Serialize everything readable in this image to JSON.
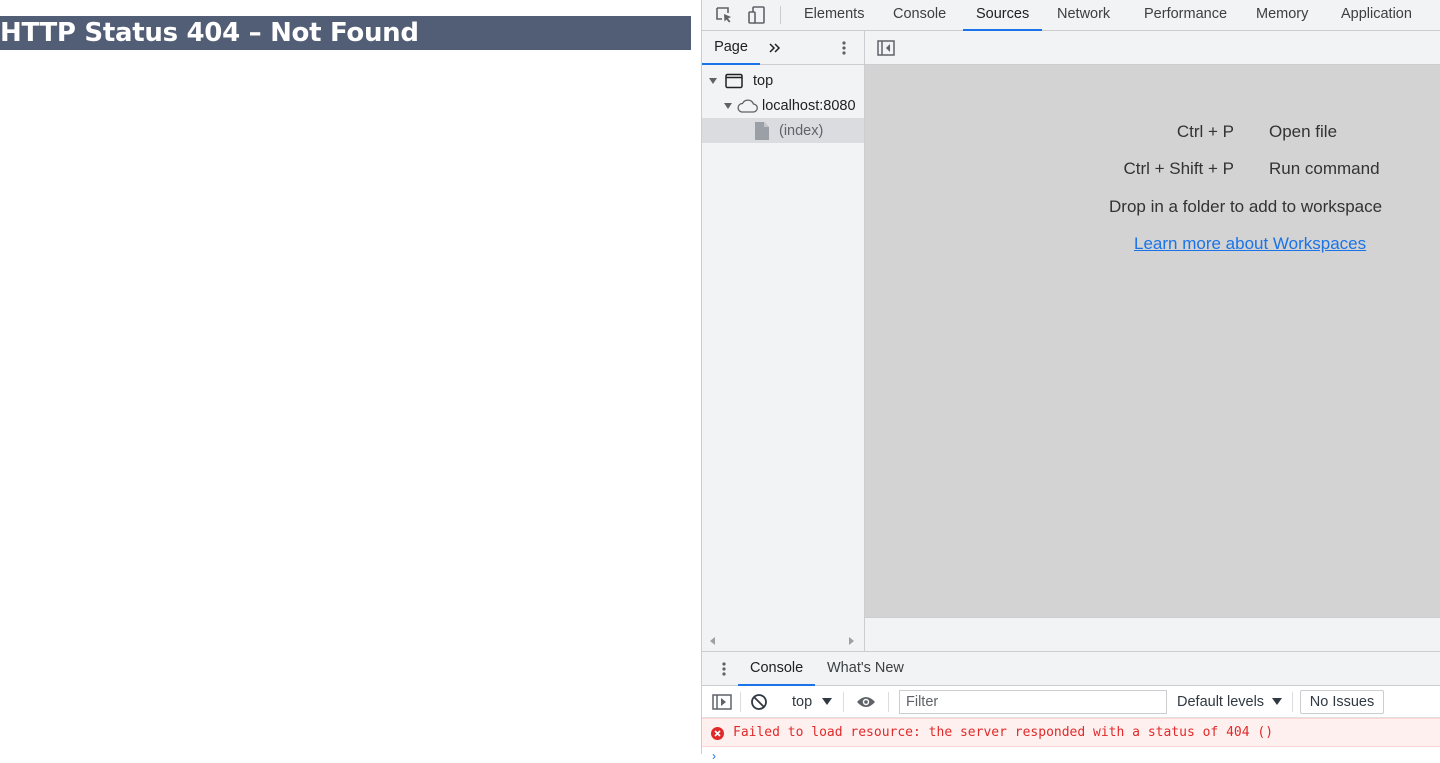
{
  "page": {
    "heading": "HTTP Status 404 – Not Found"
  },
  "devtools": {
    "tabs": [
      {
        "label": "Elements",
        "active": false
      },
      {
        "label": "Console",
        "active": false
      },
      {
        "label": "Sources",
        "active": true
      },
      {
        "label": "Network",
        "active": false
      },
      {
        "label": "Performance",
        "active": false
      },
      {
        "label": "Memory",
        "active": false
      },
      {
        "label": "Application",
        "active": false
      }
    ],
    "toolbar_icons": [
      "inspect-element-icon",
      "device-toolbar-icon"
    ],
    "navigator": {
      "tab_label": "Page",
      "more_icon": "double-chevron-icon",
      "menu_icon": "kebab-icon",
      "tree": [
        {
          "label": "top",
          "icon": "frame-icon",
          "expanded": true
        },
        {
          "label": "localhost:8080",
          "icon": "cloud-icon",
          "expanded": true
        },
        {
          "label": "(index)",
          "icon": "file-icon",
          "selected": true
        }
      ]
    },
    "editor": {
      "toggle_icon": "toggle-navigator-icon",
      "shortcuts": [
        {
          "keys": "Ctrl + P",
          "action": "Open file"
        },
        {
          "keys": "Ctrl + Shift + P",
          "action": "Run command"
        }
      ],
      "workspace_text": "Drop in a folder to add to workspace",
      "workspace_link": "Learn more about Workspaces"
    },
    "drawer": {
      "tabs": [
        {
          "label": "Console",
          "active": true
        },
        {
          "label": "What's New",
          "active": false
        }
      ],
      "console_toolbar": {
        "context": "top",
        "filter_placeholder": "Filter",
        "levels": "Default levels",
        "issues": "No Issues"
      },
      "messages": [
        {
          "level": "error",
          "text": "Failed to load resource: the server responded with a status of 404 ()"
        }
      ]
    },
    "colors": {
      "accent": "#1a73e8",
      "error": "#e02a2a",
      "title_bar": "#525d76",
      "panel_bg": "#f1f3f4",
      "editor_placeholder_bg": "#d3d3d3"
    }
  }
}
